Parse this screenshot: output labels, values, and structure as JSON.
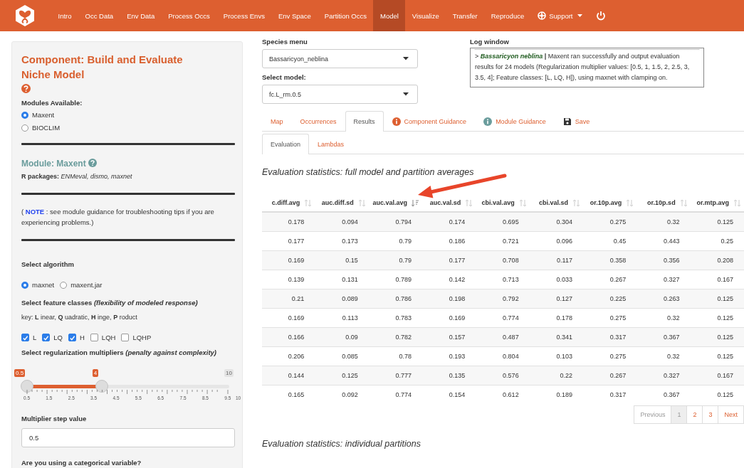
{
  "navbar": {
    "items": [
      {
        "label": "Intro",
        "selected": false
      },
      {
        "label": "Occ Data",
        "selected": false
      },
      {
        "label": "Env Data",
        "selected": false
      },
      {
        "label": "Process Occs",
        "selected": false
      },
      {
        "label": "Process Envs",
        "selected": false
      },
      {
        "label": "Env Space",
        "selected": false
      },
      {
        "label": "Partition Occs",
        "selected": false
      },
      {
        "label": "Model",
        "selected": true
      },
      {
        "label": "Visualize",
        "selected": false
      },
      {
        "label": "Transfer",
        "selected": false
      },
      {
        "label": "Reproduce",
        "selected": false
      },
      {
        "label": "Support",
        "selected": false,
        "kind": "dropdown"
      },
      {
        "kind": "power"
      }
    ]
  },
  "sidebar": {
    "component_title": "Component: Build and Evaluate Niche Model",
    "modules_label": "Modules Available:",
    "modules": [
      {
        "label": "Maxent",
        "selected": true
      },
      {
        "label": "BIOCLIM",
        "selected": false
      }
    ],
    "module_title": "Module: Maxent",
    "r_packages": "**R packages:** *ENMeval, dismo, maxnet*",
    "note": "( **NOTE** : see module guidance for troubleshooting tips if you are experiencing problems.)",
    "algorithm_label": "Select algorithm",
    "algorithms": [
      {
        "label": "maxnet",
        "selected": true
      },
      {
        "label": "maxent.jar",
        "selected": false
      }
    ],
    "features_label": "Select feature classes *(flexibility of modeled response)*",
    "features_key": "key: **L** inear, **Q** uadratic, **H** inge, **P** roduct",
    "feature_classes": [
      {
        "label": "L",
        "checked": true
      },
      {
        "label": "LQ",
        "checked": true
      },
      {
        "label": "H",
        "checked": true
      },
      {
        "label": "LQH",
        "checked": false
      },
      {
        "label": "LQHP",
        "checked": false
      }
    ],
    "reg_label": "Select regularization multipliers *(penalty against complexity)*",
    "slider": {
      "handles": [
        {
          "label": "0.5",
          "level": 0
        },
        {
          "label": "4",
          "level": 0.368
        }
      ],
      "max_label": "10",
      "tick_labels": [
        "0.5",
        "1.5",
        "2.5",
        "3.5",
        "4.5",
        "5.5",
        "6.5",
        "7.5",
        "8.5",
        "9.5",
        "10"
      ]
    },
    "step_label": "Multiplier step value",
    "step_value": "0.5",
    "categorical_label": "Are you using a categorical variable?"
  },
  "main": {
    "species_label": "Species menu",
    "species_value": "Bassaricyon_neblina",
    "model_label": "Select model:",
    "model_value": "fc.L_rm.0.5",
    "log": {
      "title": "Log window",
      "prefix": ">",
      "species": "Bassaricyon neblina",
      "separator": "|",
      "message": "Maxent ran successfully and output evaluation results for 24 models (Regularization multiplier values: [0.5, 1, 1.5, 2, 2.5, 3, 3.5, 4]; Feature classes: [L, LQ, H]), using maxnet with clamping on."
    },
    "tabs": [
      {
        "label": "Map",
        "selected": false
      },
      {
        "label": "Occurrences",
        "selected": false
      },
      {
        "label": "Results",
        "selected": true
      },
      {
        "label": "Component Guidance",
        "selected": false,
        "kind": "info"
      },
      {
        "label": "Module Guidance",
        "selected": false,
        "kind": "module-info"
      },
      {
        "label": "Save",
        "selected": false,
        "kind": "save"
      }
    ],
    "subtabs": [
      {
        "label": "Evaluation",
        "selected": true
      },
      {
        "label": "Lambdas",
        "selected": false
      }
    ],
    "heading": "Evaluation statistics: full model and partition averages",
    "table": {
      "columns": [
        {
          "label": "c.diff.avg",
          "sorted": false
        },
        {
          "label": "auc.diff.sd",
          "sorted": false
        },
        {
          "label": "auc.val.avg",
          "sorted": true
        },
        {
          "label": "auc.val.sd",
          "sorted": false
        },
        {
          "label": "cbi.val.avg",
          "sorted": false
        },
        {
          "label": "cbi.val.sd",
          "sorted": false
        },
        {
          "label": "or.10p.avg",
          "sorted": false
        },
        {
          "label": "or.10p.sd",
          "sorted": false
        },
        {
          "label": "or.mtp.avg",
          "sorted": false
        }
      ],
      "rows": [
        [
          "0.178",
          "0.094",
          "0.794",
          "0.174",
          "0.695",
          "0.304",
          "0.275",
          "0.32",
          "0.125"
        ],
        [
          "0.177",
          "0.173",
          "0.79",
          "0.186",
          "0.721",
          "0.096",
          "0.45",
          "0.443",
          "0.25"
        ],
        [
          "0.169",
          "0.15",
          "0.79",
          "0.177",
          "0.708",
          "0.117",
          "0.358",
          "0.356",
          "0.208"
        ],
        [
          "0.139",
          "0.131",
          "0.789",
          "0.142",
          "0.713",
          "0.033",
          "0.267",
          "0.327",
          "0.167"
        ],
        [
          "0.21",
          "0.089",
          "0.786",
          "0.198",
          "0.792",
          "0.127",
          "0.225",
          "0.263",
          "0.125"
        ],
        [
          "0.169",
          "0.113",
          "0.783",
          "0.169",
          "0.774",
          "0.178",
          "0.275",
          "0.32",
          "0.125"
        ],
        [
          "0.166",
          "0.09",
          "0.782",
          "0.157",
          "0.487",
          "0.341",
          "0.317",
          "0.367",
          "0.125"
        ],
        [
          "0.206",
          "0.085",
          "0.78",
          "0.193",
          "0.804",
          "0.103",
          "0.275",
          "0.32",
          "0.125"
        ],
        [
          "0.144",
          "0.125",
          "0.777",
          "0.135",
          "0.576",
          "0.22",
          "0.267",
          "0.327",
          "0.167"
        ],
        [
          "0.165",
          "0.092",
          "0.774",
          "0.154",
          "0.612",
          "0.189",
          "0.317",
          "0.367",
          "0.125"
        ]
      ]
    },
    "pagination": [
      {
        "label": "Previous",
        "disabled": true,
        "selected": false
      },
      {
        "label": "1",
        "disabled": false,
        "selected": true
      },
      {
        "label": "2",
        "disabled": false,
        "selected": false
      },
      {
        "label": "3",
        "disabled": false,
        "selected": false
      },
      {
        "label": "Next",
        "disabled": false,
        "selected": false
      }
    ],
    "heading2": "Evaluation statistics: individual partitions"
  }
}
